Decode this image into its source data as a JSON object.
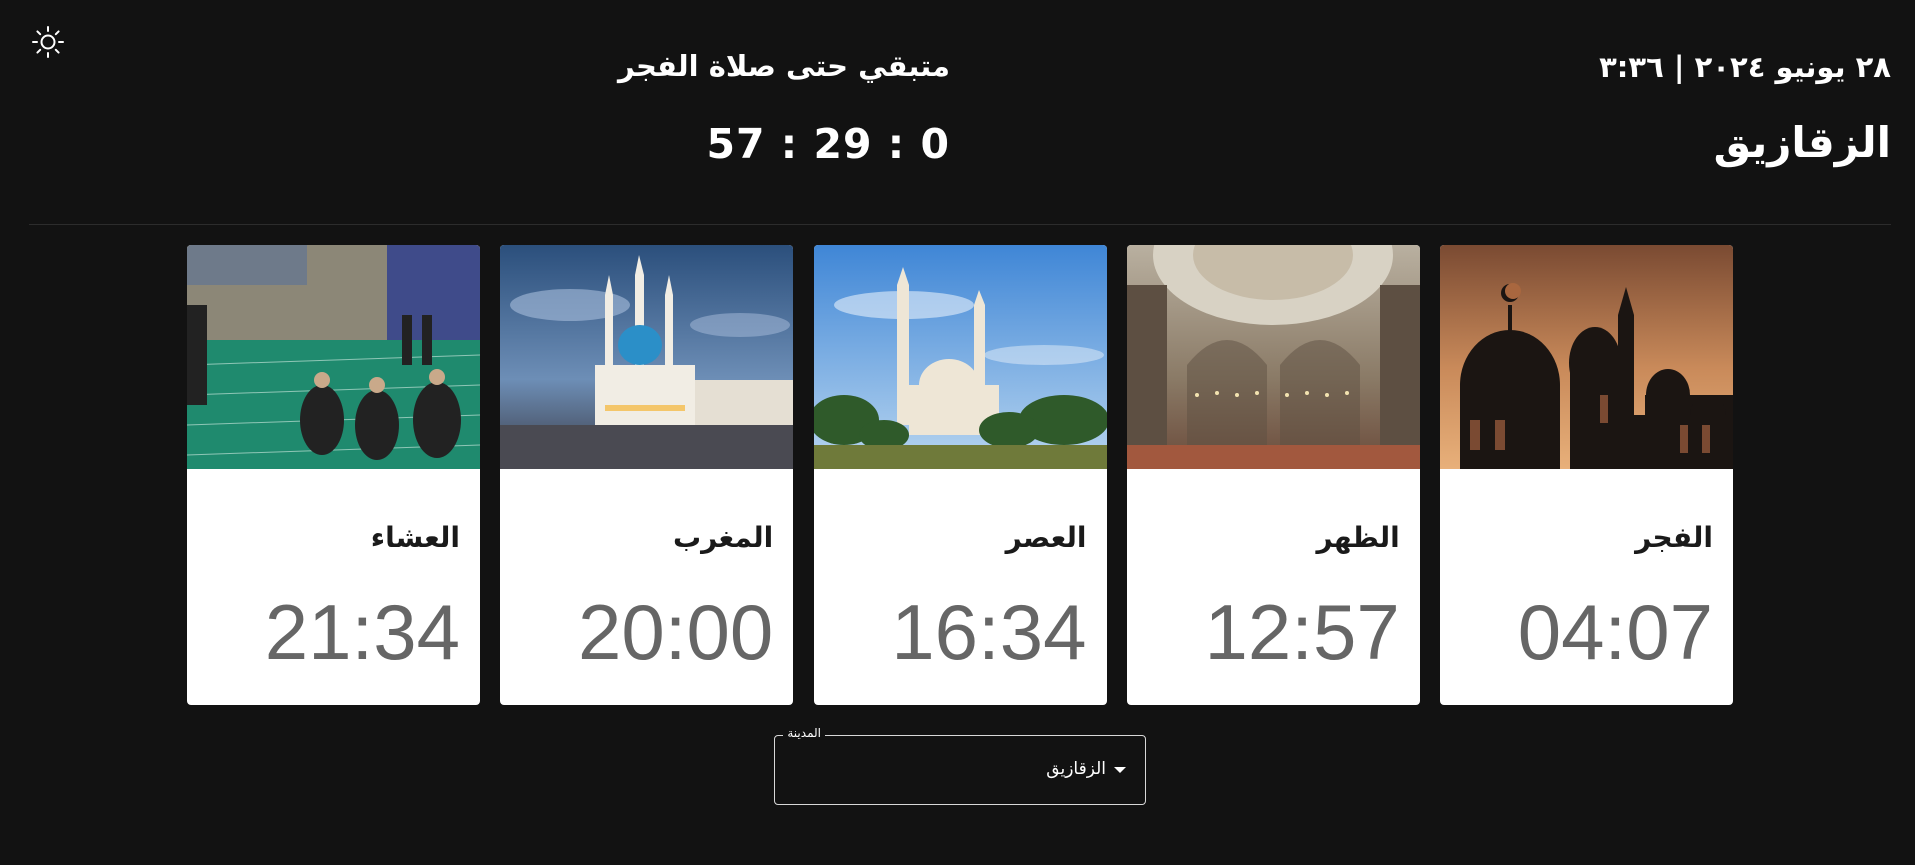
{
  "header": {
    "date_time": "٢٨ يونيو ٢٠٢٤ | ٣:٣٦",
    "city": "الزقازيق",
    "remaining_label": "متبقي حتى صلاة الفجر",
    "countdown": "57 : 29 : 0"
  },
  "theme_toggle": {
    "icon": "sun-icon"
  },
  "prayers": [
    {
      "name": "الفجر",
      "time": "04:07",
      "image": "mosque-silhouette-sunset"
    },
    {
      "name": "الظهر",
      "time": "12:57",
      "image": "mosque-interior-dome"
    },
    {
      "name": "العصر",
      "time": "16:34",
      "image": "white-mosque-palms"
    },
    {
      "name": "المغرب",
      "time": "20:00",
      "image": "blue-dome-mosque-dusk"
    },
    {
      "name": "العشاء",
      "time": "21:34",
      "image": "people-praying-in-mosque"
    }
  ],
  "city_select": {
    "label": "المدينة",
    "value": "الزقازيق"
  }
}
